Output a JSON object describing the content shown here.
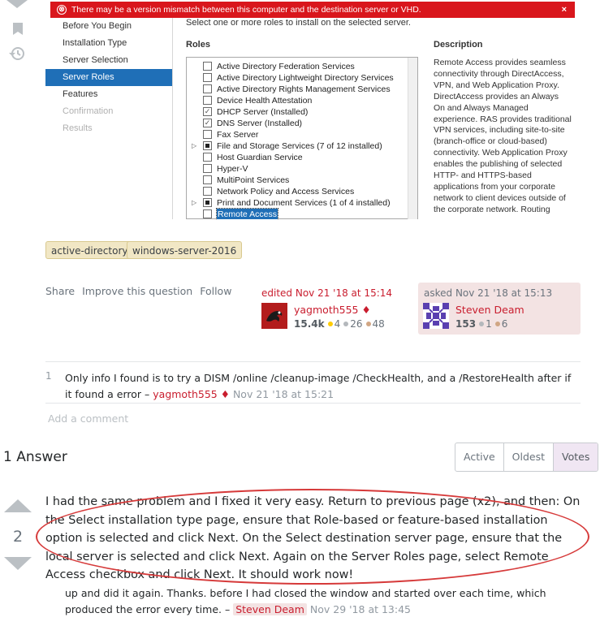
{
  "screenshot": {
    "error_text": "There may be a version mismatch between this computer and the destination server or VHD.",
    "error_close": "×",
    "error_icon": "⊗",
    "nav": [
      "Before You Begin",
      "Installation Type",
      "Server Selection",
      "Server Roles",
      "Features",
      "Confirmation",
      "Results"
    ],
    "nav_selected": "Server Roles",
    "instruction": "Select one or more roles to install on the selected server.",
    "roles_heading": "Roles",
    "description_heading": "Description",
    "roles": [
      {
        "label": "Active Directory Federation Services",
        "state": "unchecked",
        "expander": ""
      },
      {
        "label": "Active Directory Lightweight Directory Services",
        "state": "unchecked",
        "expander": ""
      },
      {
        "label": "Active Directory Rights Management Services",
        "state": "unchecked",
        "expander": ""
      },
      {
        "label": "Device Health Attestation",
        "state": "unchecked",
        "expander": ""
      },
      {
        "label": "DHCP Server (Installed)",
        "state": "checked",
        "expander": ""
      },
      {
        "label": "DNS Server (Installed)",
        "state": "checked",
        "expander": ""
      },
      {
        "label": "Fax Server",
        "state": "unchecked",
        "expander": ""
      },
      {
        "label": "File and Storage Services (7 of 12 installed)",
        "state": "partial",
        "expander": "▷"
      },
      {
        "label": "Host Guardian Service",
        "state": "unchecked",
        "expander": ""
      },
      {
        "label": "Hyper-V",
        "state": "unchecked",
        "expander": ""
      },
      {
        "label": "MultiPoint Services",
        "state": "unchecked",
        "expander": ""
      },
      {
        "label": "Network Policy and Access Services",
        "state": "unchecked",
        "expander": ""
      },
      {
        "label": "Print and Document Services (1 of 4 installed)",
        "state": "partial",
        "expander": "▷"
      },
      {
        "label": "Remote Access",
        "state": "unchecked",
        "expander": "",
        "highlighted": true
      }
    ],
    "description": "Remote Access provides seamless connectivity through DirectAccess, VPN, and Web Application Proxy. DirectAccess provides an Always On and Always Managed experience. RAS provides traditional VPN services, including site-to-site (branch-office or cloud-based) connectivity. Web Application Proxy enables the publishing of selected HTTP- and HTTPS-based applications from your corporate network to client devices outside of the corporate network. Routing"
  },
  "tags": [
    "active-directory",
    "windows-server-2016"
  ],
  "post_menu": [
    "Share",
    "Improve this question",
    "Follow"
  ],
  "editor": {
    "action": "edited Nov 21 '18 at 15:14",
    "name": "yagmoth555",
    "mod": "♦",
    "rep": "15.4k",
    "gold": "4",
    "silver": "26",
    "bronze": "48"
  },
  "asker": {
    "action": "asked Nov 21 '18 at 15:13",
    "name": "Steven Deam",
    "rep": "153",
    "silver": "1",
    "bronze": "6"
  },
  "comment": {
    "score": "1",
    "text": "Only info I found is to try a DISM /online /cleanup-image /CheckHealth, and a /RestoreHealth after if it found a error –",
    "user": "yagmoth555",
    "mod": "♦",
    "date": "Nov 21 '18 at 15:21"
  },
  "add_comment": "Add a comment",
  "answers_heading": "1 Answer",
  "sort_tabs": [
    "Active",
    "Oldest",
    "Votes"
  ],
  "answer": {
    "score": "2",
    "body": "I had the same problem and I fixed it very easy. Return to previous page (x2), and then: On the Select installation type page, ensure that Role-based or feature-based installation option is selected and click Next. On the Select destination server page, ensure that the local server is selected and click Next. Again on the Server Roles page, select Remote Access checkbox and click Next. It should work now!",
    "comment_text": "up and did it again. Thanks. before I had closed the window and started over each time, which produced the error every time. –",
    "comment_user": "Steven Deam",
    "comment_date": "Nov 29 '18 at 13:45"
  }
}
